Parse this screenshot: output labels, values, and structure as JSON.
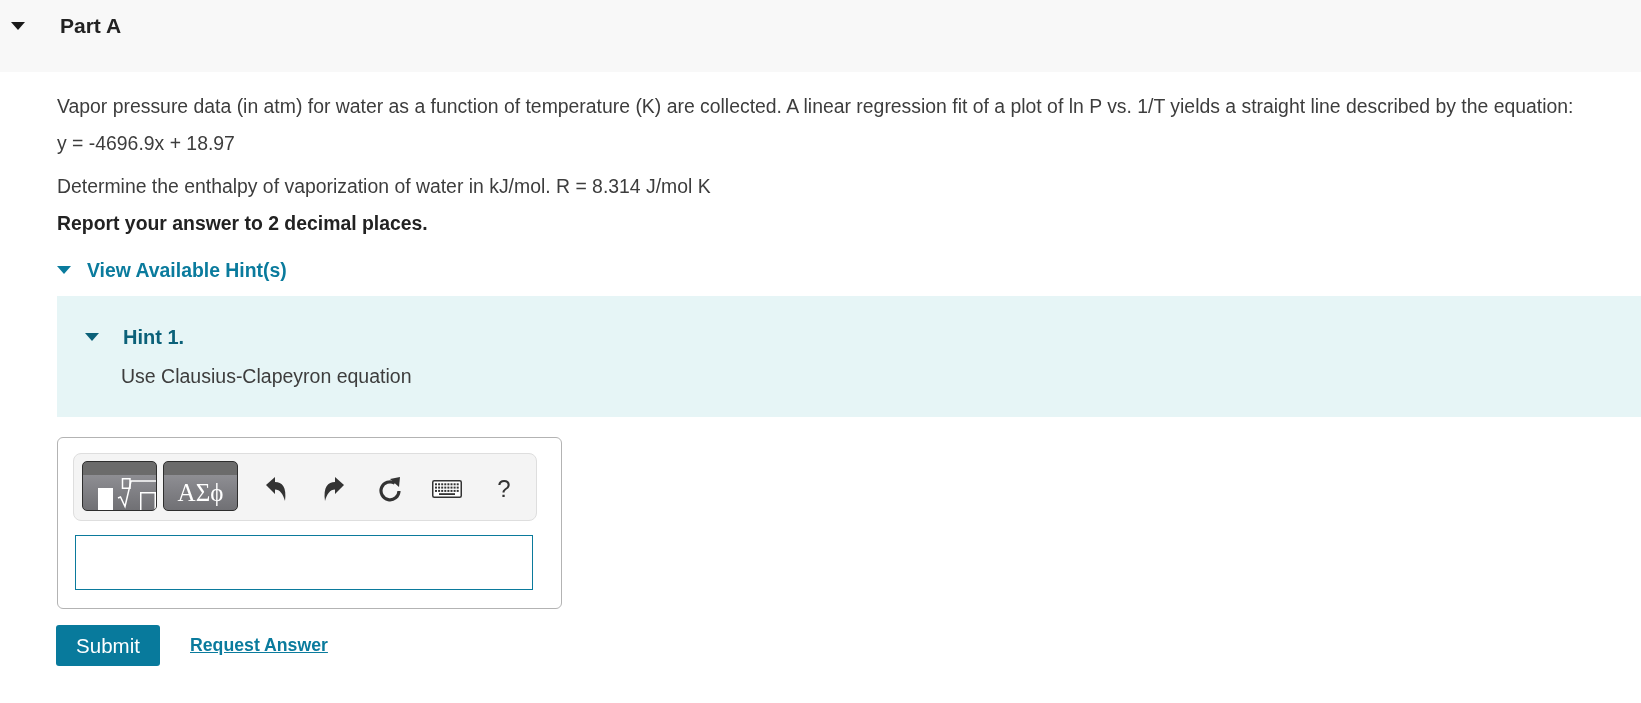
{
  "part": {
    "title": "Part A",
    "expanded": true
  },
  "question": [
    {
      "kind": "plain",
      "text": "Vapor pressure data (in atm) for water as a function of temperature (K) are collected. A linear regression fit of a plot of ln P vs. 1/T yields a straight line described by the equation:"
    },
    {
      "kind": "plain",
      "text": "y = -4696.9x + 18.97"
    },
    {
      "kind": "plain",
      "text": "Determine the enthalpy of vaporization of water in kJ/mol. R = 8.314 J/mol K"
    },
    {
      "kind": "emphasis",
      "text": "Report your answer to 2 decimal places."
    }
  ],
  "hints": {
    "label": "View Available Hint(s)",
    "expanded": true,
    "items": [
      {
        "title": "Hint 1.",
        "expanded": true,
        "text": "Use Clausius-Clapeyron equation"
      }
    ]
  },
  "answer": {
    "toolbar": [
      {
        "kind": "template"
      },
      {
        "kind": "symbols",
        "label": "ΑΣϕ"
      },
      {
        "kind": "undo"
      },
      {
        "kind": "redo"
      },
      {
        "kind": "reset"
      },
      {
        "kind": "keyboard"
      },
      {
        "kind": "help",
        "label": "?"
      }
    ]
  },
  "actions": [
    {
      "kind": "primary",
      "label": "Submit"
    },
    {
      "kind": "link",
      "label": "Request Answer"
    }
  ]
}
